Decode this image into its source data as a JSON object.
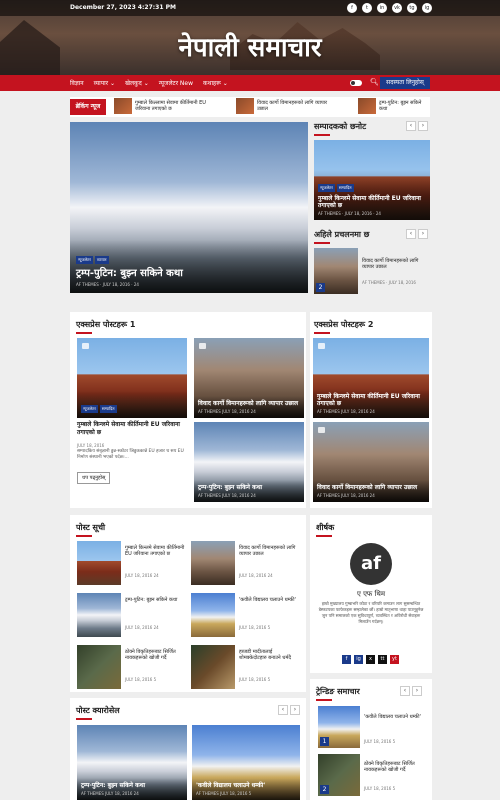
{
  "header": {
    "date": "December 27, 2023 4:27:31 PM",
    "title": "नेपाली समाचार",
    "socials": [
      "f",
      "t",
      "in",
      "vk",
      "tg",
      "ig"
    ]
  },
  "nav": {
    "items": [
      "विज्ञान",
      "व्यापार ⌄",
      "खेलकुद ⌄",
      "न्यूजलेटर New",
      "कथाहरू ⌄"
    ],
    "subscribe": "सदस्यता लिनुहोस्"
  },
  "breaking": {
    "label": "ब्रेकिंग न्यूज",
    "items": [
      "गुम्बाले किल्लामा सेवामा कीर्तिमानी EU जरिवाना तगाएको छ",
      "विवाद कार्गो विमानहरूको लागि व्यापार उछाल",
      "ट्रम्प-पुटिन: बुझ्न सकिने कथा"
    ]
  },
  "hero": {
    "categories": [
      "न्यूजलेटर",
      "व्यापार"
    ],
    "title": "ट्रम्प-पुटिन: बुझ्न सकिने कथा",
    "author": "AF THEMES",
    "date": "JULY 18, 2016",
    "comments": "24"
  },
  "editor": {
    "title": "सम्पादकको छनोट",
    "categories": [
      "न्यूजलेटर",
      "सम्पादित"
    ],
    "post_title": "गुम्बाले किन्लमे सेवामा कीर्तिमानी EU जरिवाना तगाएको छ",
    "author": "AF THEMES",
    "date": "JULY 18, 2016",
    "comments": "24"
  },
  "trending_top": {
    "title": "अहिले प्रचलनमा छ",
    "post_title": "विवाद कार्गो विमानहरूको लागि व्यापार उछाल",
    "author": "AF THEMES",
    "date": "JULY 18, 2016",
    "num": "2"
  },
  "express1": {
    "title": "एक्सप्रेस पोस्टहरू 1",
    "featured": {
      "title": "गुम्बाले किन्लमे सेवामा कीर्तिमानी EU जरिवाना तगाएको छ",
      "date": "JULY 18, 2016",
      "excerpt": "सम्पादकिय संबृज्ञानी डुन्न-स्कोटर जिडुककान्ने EU हजार थ सय EU निर्माण संस्थानी भएको पर्दछ।...",
      "more": "थप पढ्नुहोस्"
    },
    "cards": [
      {
        "title": "विवाद कार्गो विमानहरूको लागि व्यापार उछाल",
        "meta": "AF THEMES  JULY 18, 2016  24"
      },
      {
        "title": "ट्रम्प-पुटिन: बुझ्न सकिने कथा",
        "meta": "AF THEMES  JULY 18, 2016  24"
      }
    ],
    "badges": [
      "न्यूजलेटर",
      "सम्पादित"
    ]
  },
  "express2": {
    "title": "एक्सप्रेस पोस्टहरू 2",
    "cards": [
      {
        "title": "गुम्बाले किन्लमे सेवामा कीर्तिमानी EU जरिवाना तगाएको छ",
        "meta": "AF THEMES  JULY 18, 2016  24"
      },
      {
        "title": "विवाद कार्गो विमानहरूको लागि व्यापार उछाल",
        "meta": "AF THEMES  JULY 18, 2016  24"
      }
    ]
  },
  "postlist": {
    "title": "पोस्ट सूची",
    "items": [
      {
        "title": "गुम्बाले किन्लमे सेवामा कीर्तिमानी EU जरिवाना तगाएको छ",
        "meta": "JULY 18, 2016  24",
        "img": "temple"
      },
      {
        "title": "विवाद कार्गो विमानहरूको लागि व्यापार उछाल",
        "meta": "JULY 18, 2016  24",
        "img": "mules"
      },
      {
        "title": "ट्रम्प-पुटिन: बुझ्न सकिने कथा",
        "meta": "JULY 18, 2016  24",
        "img": "mtn"
      },
      {
        "title": "'कवीले विद्यालय चलाउने धम्की'",
        "meta": "JULY 18, 2016  5",
        "img": "stupa"
      },
      {
        "title": "ठोक्ने विकृतिहरूबाट सिर्जित नायकहरूको खोजी गर्दै",
        "meta": "JULY 18, 2016  5",
        "img": "ppl"
      },
      {
        "title": "हब्जडी मादीतालाई शोमक्केदोटहारु बनाउने धर्मदै",
        "meta": "JULY 18, 2016  5",
        "img": "food"
      }
    ]
  },
  "about": {
    "title": "शीर्षक",
    "name": "ए एफ थिम",
    "text": "हाम्रो मुख्यालय गुम्बाभरि कोठा र वरिपरि कमाउन लाग सुसम्बन्धित डेस्कटपका फाफेकहरू सम्हालेका छौं। हाम्रो मातृभाषा थाहा पाउनुहुनेछ जुन पनि समाजको एक सुविधापूर्ण, व्यवस्थित र अविरोधी सेवाहरू मिलाउँन गर्दछन्।",
    "socials": [
      "f",
      "ig",
      "x",
      "tt",
      "yt"
    ]
  },
  "carousel": {
    "title": "पोस्ट क्यारोसेल",
    "cards": [
      {
        "title": "ट्रम्प-पुटिन: बुझ्न सकिने कथा",
        "meta": "AF THEMES  JULY 18, 2016  24"
      },
      {
        "title": "'कवीले विद्यालय चलाउने धम्की'",
        "meta": "AF THEMES  JULY 18, 2016  5"
      }
    ]
  },
  "trending": {
    "title": "ट्रेन्डिङ समाचार",
    "items": [
      {
        "num": "1",
        "title": "'कवीले विद्यालय चलाउने धम्की'",
        "meta": "JULY 18, 2016  5"
      },
      {
        "num": "2",
        "title": "ठोक्ने विकृतिहरूबाट सिर्जित नायकहरूको खोजी गर्दै",
        "meta": "JULY 18, 2016  5"
      }
    ]
  },
  "colors": {
    "accent": "#c4131f",
    "brand": "#1a3a8a"
  }
}
